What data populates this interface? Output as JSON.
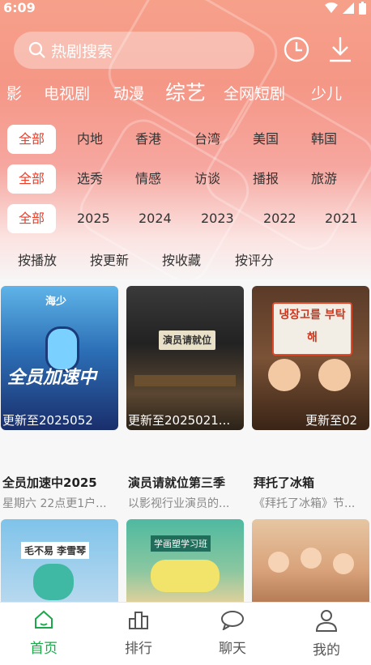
{
  "status": {
    "time": "6:09"
  },
  "search": {
    "placeholder": "热剧搜索"
  },
  "categories": [
    "影",
    "电视剧",
    "动漫",
    "综艺",
    "全网短剧",
    "少儿"
  ],
  "filters": {
    "region": [
      "全部",
      "内地",
      "香港",
      "台湾",
      "美国",
      "韩国"
    ],
    "type": [
      "全部",
      "选秀",
      "情感",
      "访谈",
      "播报",
      "旅游"
    ],
    "year": [
      "全部",
      "2025",
      "2024",
      "2023",
      "2022",
      "2021"
    ]
  },
  "sorts": [
    "按播放",
    "按更新",
    "按收藏",
    "按评分"
  ],
  "cards": [
    {
      "title": "全员加速中2025",
      "subtitle": "星期六 22点更1户...",
      "update": "更新至2025052",
      "logo": "海少"
    },
    {
      "title": "演员请就位第三季",
      "subtitle": "以影视行业演员的...",
      "update": "更新至2025021...",
      "sign": "演员请就位"
    },
    {
      "title": "拜托了冰箱",
      "subtitle": "《拜托了冰箱》节...",
      "update": "更新至02",
      "sign": "냉장고를 부탁해"
    }
  ],
  "cards2": [
    {
      "caption": "毛不易 李雪琴"
    },
    {
      "caption": "学画塑学习班"
    },
    {
      "caption": ""
    }
  ],
  "tabbar": [
    {
      "label": "首页",
      "icon": "home-icon"
    },
    {
      "label": "排行",
      "icon": "ranking-icon"
    },
    {
      "label": "聊天",
      "icon": "chat-icon"
    },
    {
      "label": "我的",
      "icon": "profile-icon"
    }
  ],
  "colors": {
    "accent": "#ee3b26",
    "tab_active": "#1ba84a",
    "hero_top": "#f6a08a"
  }
}
